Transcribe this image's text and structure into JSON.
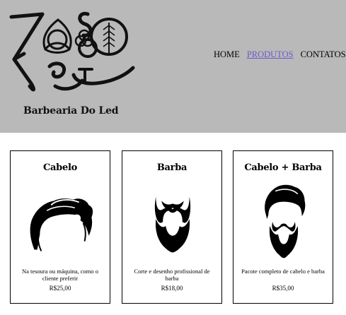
{
  "header": {
    "brand_name": "Barbearia Do Led",
    "logo_alt": "ZOSO"
  },
  "nav": {
    "items": [
      {
        "label": "HOME"
      },
      {
        "label": "PRODUTOS"
      },
      {
        "label": "CONTATOS"
      }
    ],
    "active_index": 1,
    "active_color": "#6a5acd"
  },
  "products": [
    {
      "title": "Cabelo",
      "icon": "hair-icon",
      "description": "Na tesoura ou máquina, como o cliente preferir",
      "price": "R$25,00"
    },
    {
      "title": "Barba",
      "icon": "beard-icon",
      "description": "Corte e desenho profissional de barba",
      "price": "R$18,00"
    },
    {
      "title": "Cabelo + Barba",
      "icon": "hair-and-beard-icon",
      "description": "Pacote completo de cabelo e barba",
      "price": "R$35,00"
    }
  ],
  "colors": {
    "header_bg": "#b9b9b9",
    "page_bg": "#ffffff"
  }
}
